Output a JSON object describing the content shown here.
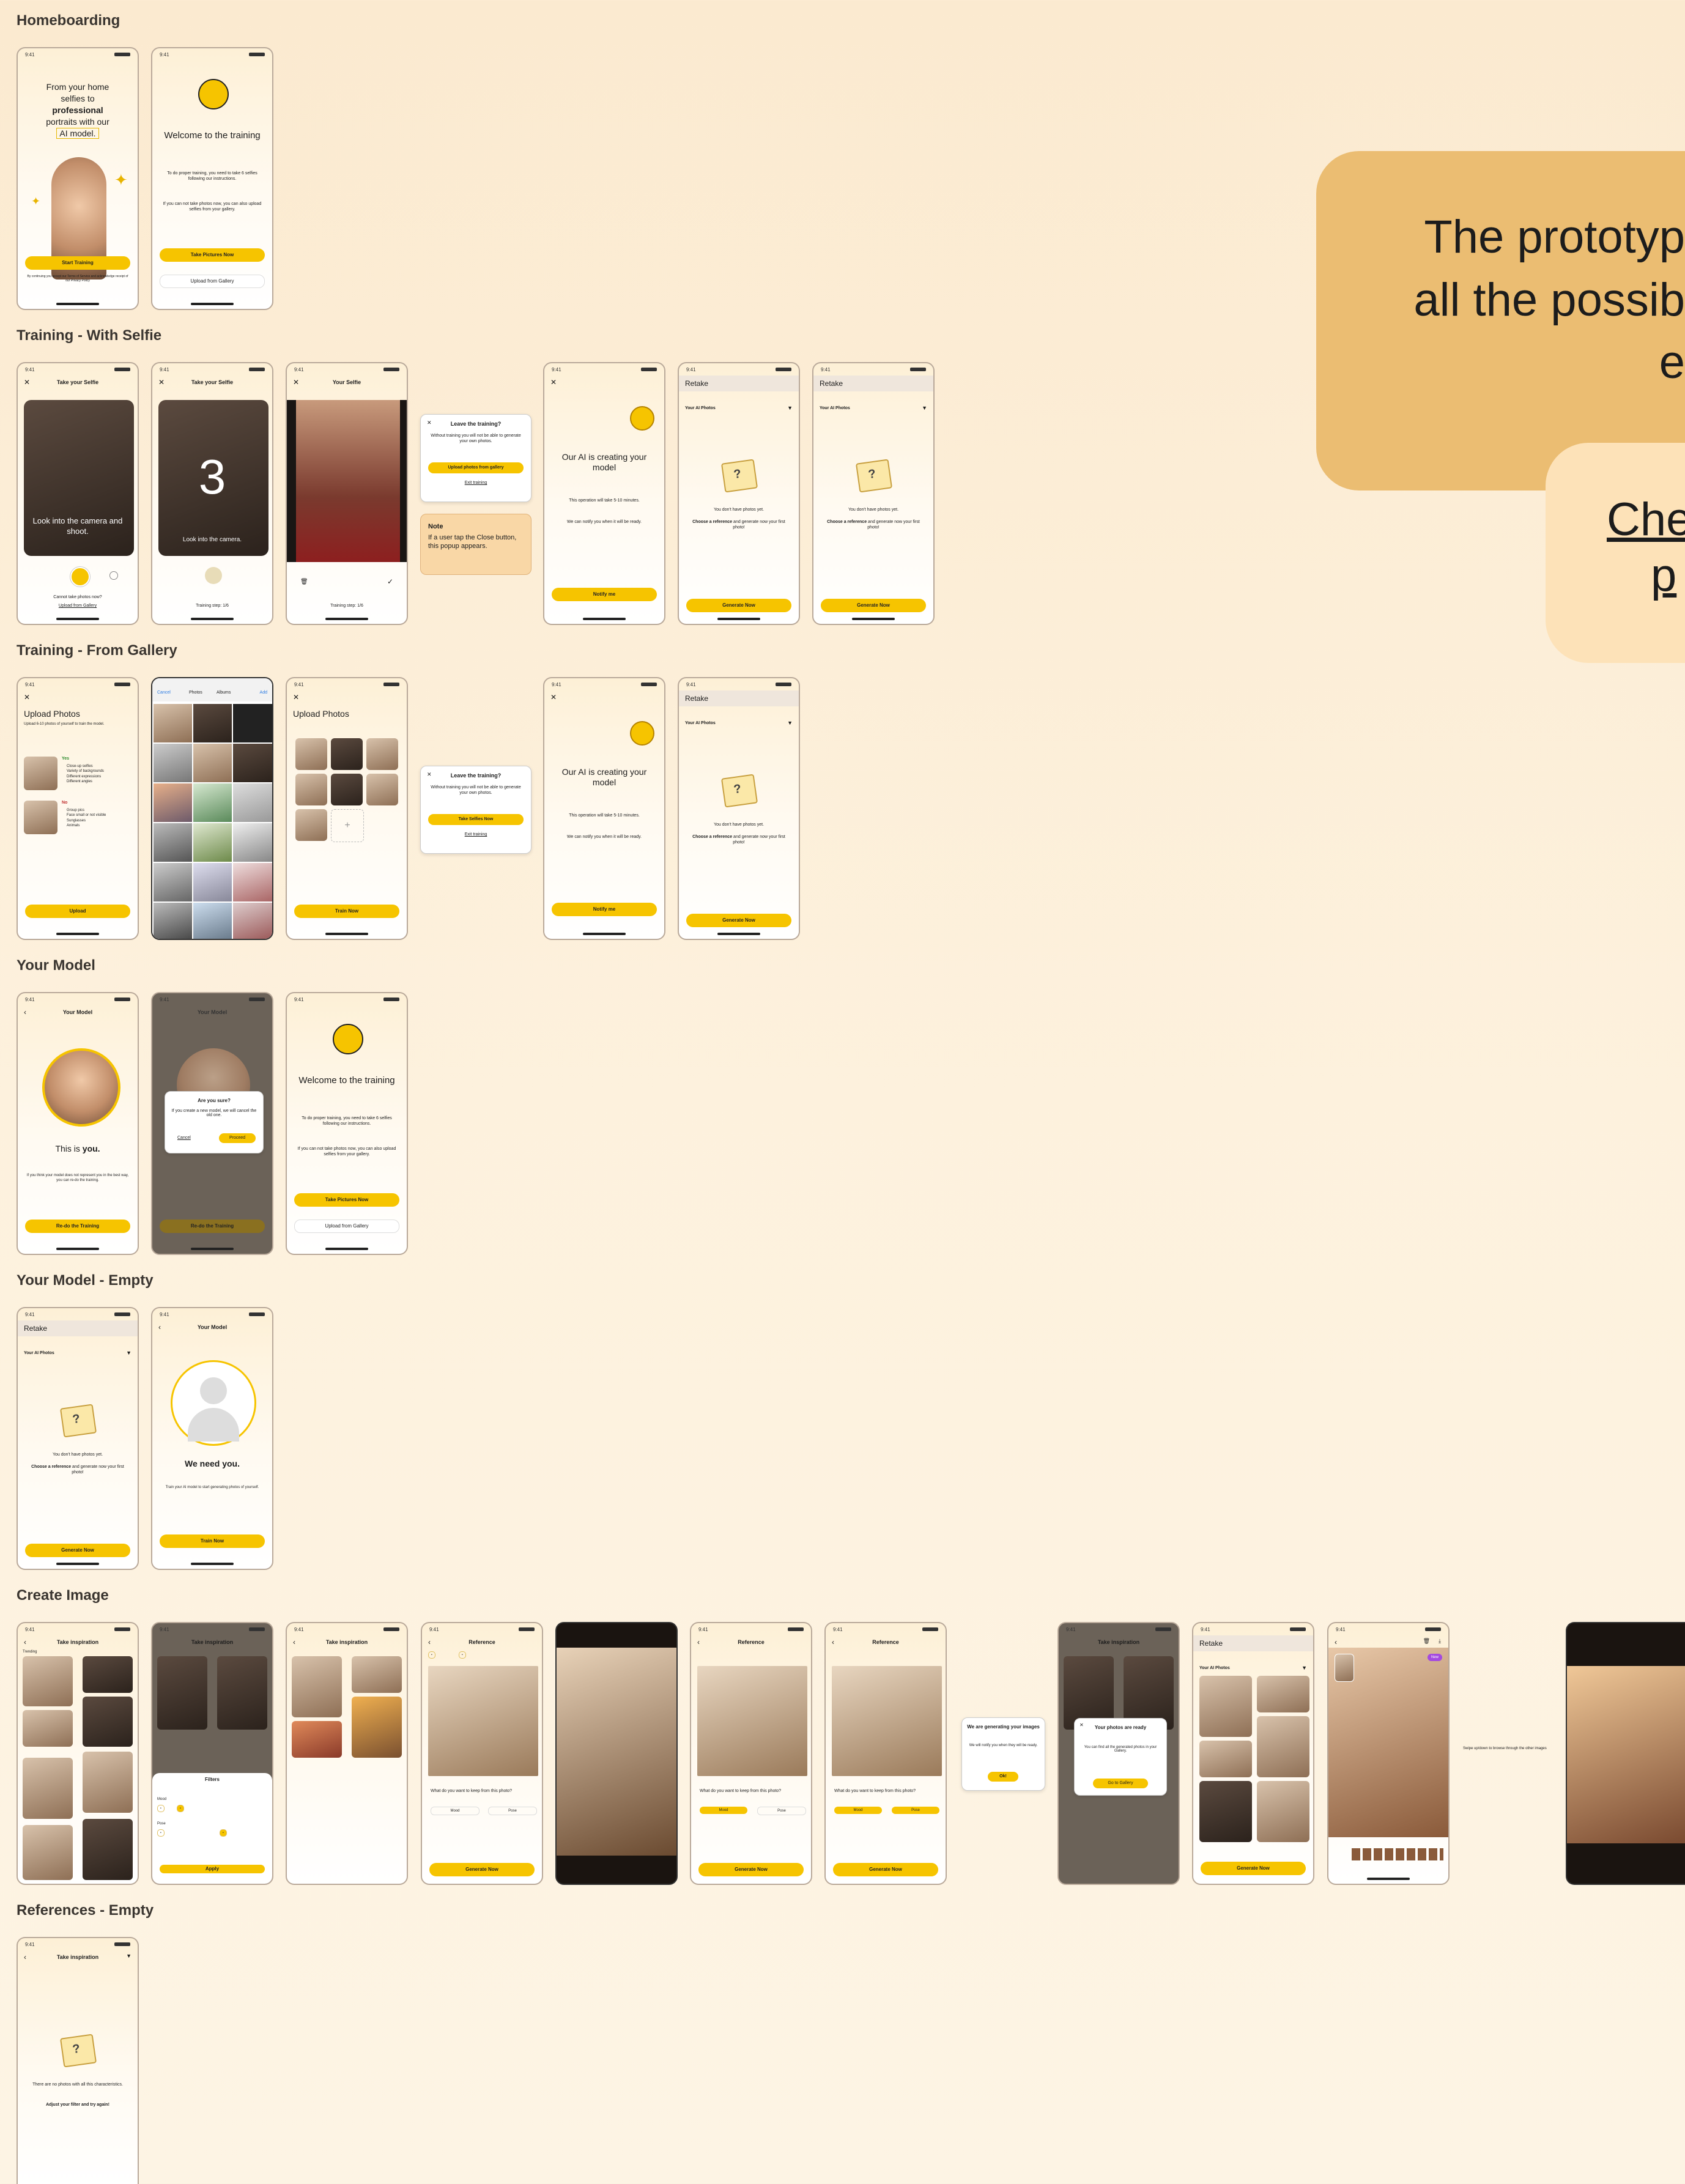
{
  "sections": {
    "homeboarding": "Homeboarding",
    "training_selfie": "Training - With Selfie",
    "training_gallery": "Training - From Gallery",
    "your_model": "Your Model",
    "your_model_empty": "Your Model - Empty",
    "create_image": "Create Image",
    "references_empty": "References - Empty"
  },
  "status_time": "9:41",
  "home": {
    "hero_line1": "From your home",
    "hero_line2": "selfies to",
    "hero_bold": "professional",
    "hero_line3": "portraits with our",
    "hero_line4": "AI model.",
    "start_training": "Start Training",
    "terms": "By continuing you accept our Terms of Service and acknowledge receipt of our Privacy Policy"
  },
  "welcome": {
    "title": "Welcome to the training",
    "body1": "To do proper training, you need to take 6 selfies following our instructions.",
    "body2": "If you can not take photos now, you can also upload selfies from your gallery.",
    "take_pictures": "Take Pictures Now",
    "upload_gallery": "Upload from Gallery"
  },
  "selfie": {
    "header": "Take your Selfie",
    "header2": "Your Selfie",
    "look_shoot": "Look into the camera and shoot.",
    "look": "Look into the camera.",
    "countdown": "3",
    "cannot": "Cannot take photos now?",
    "upload_link": "Upload from Gallery",
    "step": "Training step: 1/6"
  },
  "leave": {
    "title": "Leave the training?",
    "body": "Without training you will not be able to generate your own photos.",
    "upload_btn": "Upload photos from gallery",
    "take_btn": "Take Selfies Now",
    "exit": "Exit training"
  },
  "note": {
    "title": "Note",
    "body": "If a user tap the Close button, this popup appears."
  },
  "creating": {
    "title": "Our AI is creating your model",
    "body1": "This operation will take 5-10 minutes.",
    "body2": "We can notify you when it will be ready.",
    "notify": "Notify me"
  },
  "retake": {
    "logo": "Retake",
    "your_ai_photos": "Your AI Photos",
    "no_photos": "You don't have photos yet.",
    "choose_bold": "Choose a reference",
    "choose_rest": "and generate now your first photo!",
    "generate": "Generate Now"
  },
  "upload": {
    "title": "Upload Photos",
    "desc": "Upload 6-10 photos of yourself to train the model.",
    "yes": "Yes",
    "yes_items": [
      "Close-up selfies",
      "Variety of backgrounds",
      "Different expressions",
      "Different angles"
    ],
    "no": "No",
    "no_items": [
      "Group pics",
      "Face small or not visible",
      "Sunglasses",
      "Animals"
    ],
    "upload_btn": "Upload",
    "train_now": "Train Now",
    "gallery_tabs": [
      "Photos",
      "Albums"
    ],
    "cancel": "Cancel",
    "add": "Add"
  },
  "model": {
    "header": "Your Model",
    "this_is": "This is",
    "you": "you.",
    "body": "If you think your model does not represent you in the best way, you can re-do the training.",
    "redo": "Re-do the Training",
    "confirm_title": "Are you sure?",
    "confirm_body": "If you create a new model, we will cancel the old one.",
    "cancel": "Cancel",
    "proceed": "Proceed",
    "need_you": "We need you.",
    "train_body": "Train your AI model to start generating photos of yourself.",
    "train_now": "Train Now"
  },
  "create": {
    "inspiration": "Take inspiration",
    "references": "Reference",
    "trending": "Trending",
    "filters": "Filters",
    "apply": "Apply",
    "mood": "Mood",
    "pose": "Pose",
    "question": "What do you want to keep from this photo?",
    "generate": "Generate Now",
    "generating_title": "We are generating your images",
    "generating_body": "We will notify you when they will be ready.",
    "ok": "Ok!",
    "ready_title": "Your photos are ready",
    "ready_body": "You can find all the generated photos in your Gallery.",
    "go_gallery": "Go to Gallery",
    "swipe": "Swipe up/down to browse through the other images",
    "new_badge": "New"
  },
  "refempty": {
    "none": "There are no photos with all this characteristics.",
    "adjust": "Adjust your filter and try again!"
  },
  "callout": {
    "main_line1": "The prototyp",
    "main_line2": "all the possib",
    "main_line3": "e",
    "link_line1": "Che",
    "link_line2": "p"
  },
  "colors": {
    "accent": "#f6c400",
    "callout_main": "#ebbd72",
    "callout_link": "#fde2b8"
  }
}
